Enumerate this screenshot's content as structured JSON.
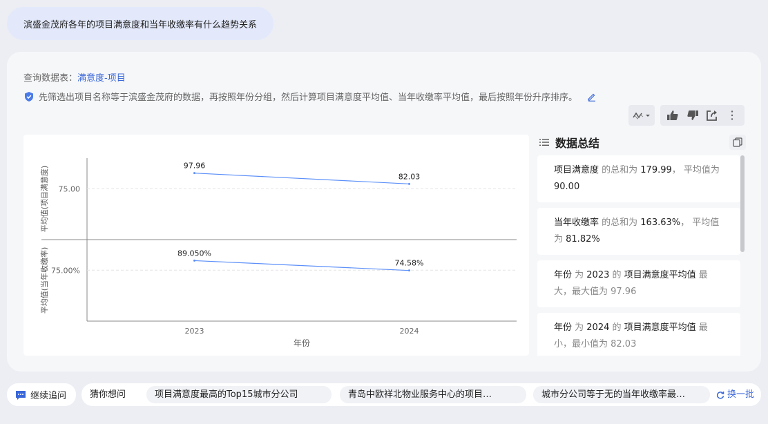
{
  "question": "滨盛金茂府各年的项目满意度和当年收缴率有什么趋势关系",
  "source": {
    "label": "查询数据表：",
    "value": "满意度-项目"
  },
  "description": "先筛选出项目名称等于滨盛金茂府的数据，再按照年份分组，然后计算项目满意度平均值、当年收缴率平均值，最后按照年份升序排序。",
  "summary": {
    "title": "数据总结",
    "items": [
      {
        "p1": "项目满意度",
        "p2": " 的总和为 ",
        "p3": "179.99",
        "p4": "， 平均值为 ",
        "p5": "90.00",
        "p6": ""
      },
      {
        "p1": "当年收缴率",
        "p2": " 的总和为 ",
        "p3": "163.63%",
        "p4": "， 平均值为 ",
        "p5": "81.82%",
        "p6": ""
      },
      {
        "p1": "年份",
        "p2": " 为 ",
        "p3": "2023",
        "p4": " 的 ",
        "p5": "项目满意度平均值",
        "p6": " 最大，最大值为 97.96"
      },
      {
        "p1": "年份",
        "p2": " 为 ",
        "p3": "2024",
        "p4": " 的 ",
        "p5": "项目满意度平均值",
        "p6": " 最小，最小值为 82.03"
      }
    ]
  },
  "chart_data": {
    "type": "line",
    "categories": [
      "2023",
      "2024"
    ],
    "xlabel": "年份",
    "panels": [
      {
        "ylabel": "平均值(项目满意度)",
        "ytick": "75.00",
        "ytick_value": 75,
        "ylim": [
          0,
          120
        ],
        "values": [
          97.96,
          82.03
        ],
        "labels": [
          "97.96",
          "82.03"
        ]
      },
      {
        "ylabel": "平均值(当年收缴率)",
        "ytick": "75.00%",
        "ytick_value": 75,
        "ylim": [
          0,
          120
        ],
        "values": [
          89.05,
          74.58
        ],
        "labels": [
          "89.050%",
          "74.58%"
        ]
      }
    ],
    "line_color": "#5b8ff9",
    "grid": true
  },
  "bottom": {
    "follow_label": "继续追问",
    "guess_label": "猜你想问",
    "chips": [
      "项目满意度最高的Top15城市分公司",
      "青岛中欧祥北物业服务中心的项目…",
      "城市分公司等于无的当年收缴率最…"
    ],
    "refresh_label": "换一批"
  },
  "colors": {
    "accent": "#3a67d8",
    "question_bg": "#e3e9fb"
  }
}
